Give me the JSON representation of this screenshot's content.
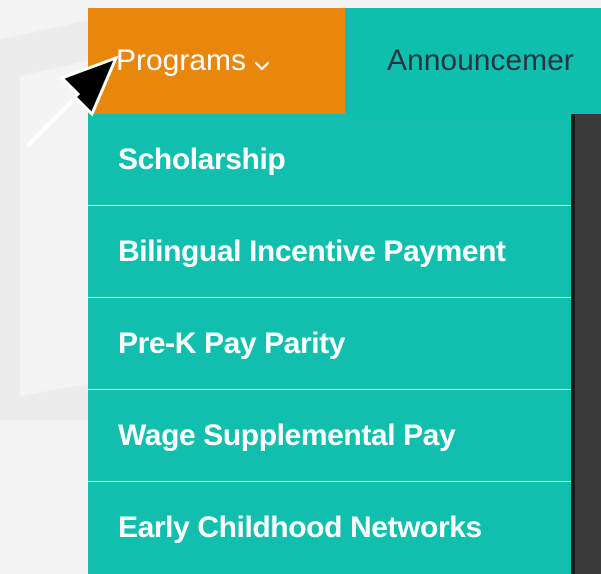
{
  "nav": {
    "programs_label": "Programs",
    "announcements_label": "Announcemer"
  },
  "dropdown": {
    "items": [
      {
        "label": "Scholarship"
      },
      {
        "label": "Bilingual Incentive Payment"
      },
      {
        "label": "Pre-K Pay Parity"
      },
      {
        "label": "Wage Supplemental Pay"
      },
      {
        "label": "Early Childhood Networks"
      }
    ]
  },
  "colors": {
    "nav_teal": "#0fbfae",
    "active_orange": "#e8870c",
    "menu_text": "#ffffff"
  },
  "icons": {
    "chevron": "chevron-down-icon",
    "pointer_arrow": "arrow-icon"
  }
}
